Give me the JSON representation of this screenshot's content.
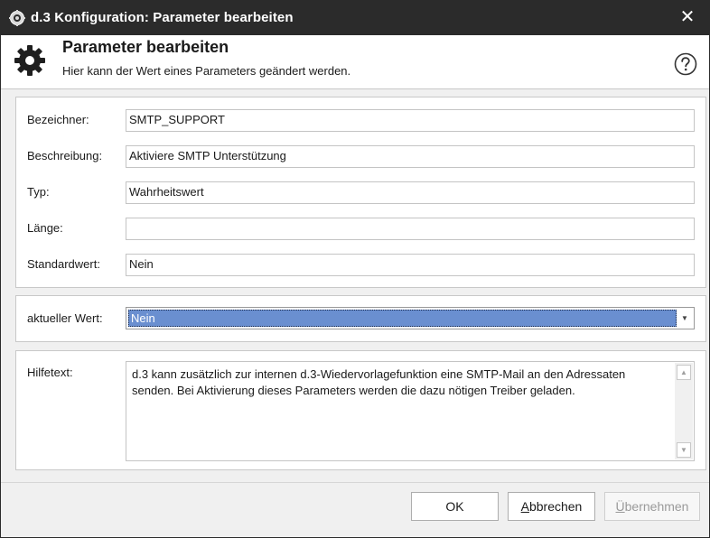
{
  "window": {
    "title": "d.3 Konfiguration: Parameter bearbeiten",
    "close_glyph": "✕"
  },
  "header": {
    "title": "Parameter bearbeiten",
    "subtitle": "Hier kann der Wert eines Parameters geändert werden.",
    "icon": "gear-icon",
    "help_icon": "help-circle-icon"
  },
  "fields": {
    "bezeichner": {
      "label": "Bezeichner:",
      "value": "SMTP_SUPPORT"
    },
    "beschreibung": {
      "label": "Beschreibung:",
      "value": "Aktiviere SMTP Unterstützung"
    },
    "typ": {
      "label": "Typ:",
      "value": "Wahrheitswert"
    },
    "laenge": {
      "label": "Länge:",
      "value": ""
    },
    "standardwert": {
      "label": "Standardwert:",
      "value": "Nein"
    }
  },
  "current": {
    "label": "aktueller Wert:",
    "selected": "Nein"
  },
  "helptext": {
    "label": "Hilfetext:",
    "text": "d.3 kann zusätzlich zur internen d.3-Wiedervorlagefunktion eine SMTP-Mail an den Adressaten senden. Bei Aktivierung dieses Parameters werden die dazu nötigen Treiber geladen."
  },
  "buttons": {
    "ok": "OK",
    "cancel_mnemonic": "A",
    "cancel_rest": "bbrechen",
    "apply_mnemonic": "Ü",
    "apply_rest": "bernehmen"
  },
  "colors": {
    "titlebar": "#2b2b2b",
    "selection": "#6a8fd0",
    "dialog_bg": "#f0f0f0"
  }
}
